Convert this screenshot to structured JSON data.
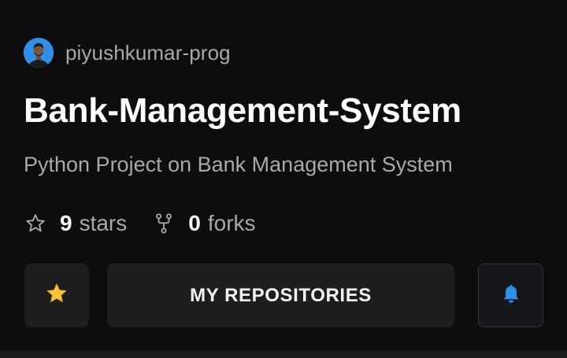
{
  "repo": {
    "owner": "piyushkumar-prog",
    "name": "Bank-Management-System",
    "description": "Python Project on Bank Management System",
    "stars_count": "9",
    "stars_label": "stars",
    "forks_count": "0",
    "forks_label": "forks"
  },
  "actions": {
    "star_icon": "star-emoji-icon",
    "repositories_label": "MY REPOSITORIES",
    "bell_icon": "bell-icon"
  },
  "colors": {
    "background": "#0d0d0f",
    "button_bg": "#1e1e21",
    "accent_blue": "#2f8fe8",
    "star_yellow": "#f7c23a",
    "muted_text": "#a9a9ad"
  }
}
